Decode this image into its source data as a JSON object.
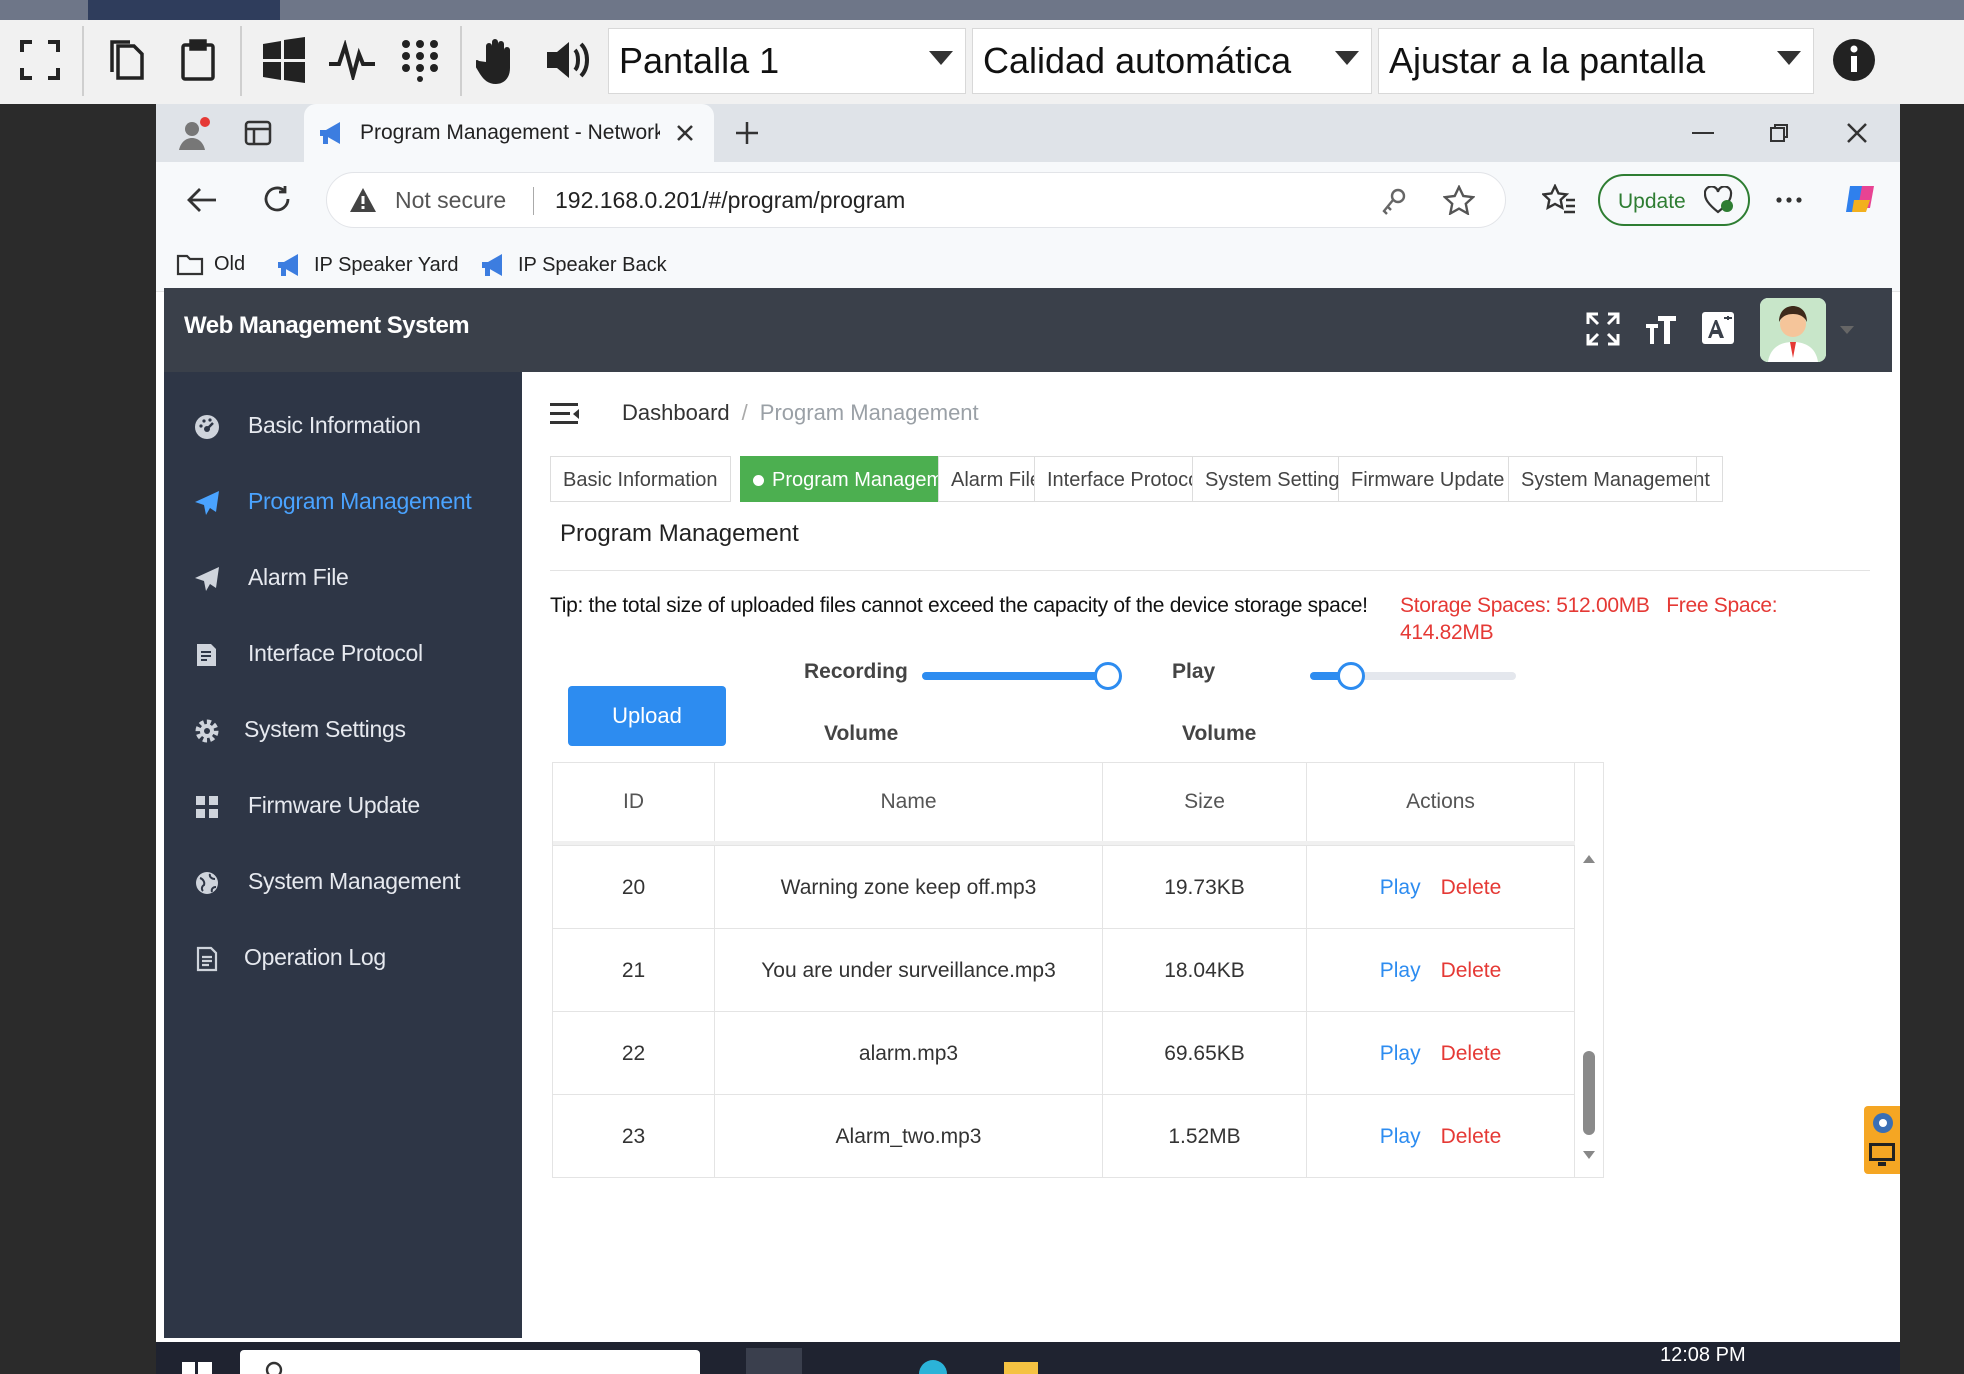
{
  "remote_toolbar": {
    "screen_select": "Pantalla 1",
    "quality_select": "Calidad automática",
    "fit_select": "Ajustar a la pantalla"
  },
  "browser": {
    "tab_title": "Program Management - Network",
    "not_secure": "Not secure",
    "url": "192.168.0.201/#/program/program",
    "update_label": "Update",
    "bookmarks": [
      {
        "label": "Old"
      },
      {
        "label": "IP Speaker Yard"
      },
      {
        "label": "IP Speaker Back"
      }
    ]
  },
  "app": {
    "title": "Web Management System",
    "sidebar": [
      {
        "label": "Basic Information",
        "icon": "dashboard-icon"
      },
      {
        "label": "Program Management",
        "icon": "send-icon",
        "active": true
      },
      {
        "label": "Alarm File",
        "icon": "send-icon"
      },
      {
        "label": "Interface Protocol",
        "icon": "document-edit-icon"
      },
      {
        "label": "System Settings",
        "icon": "gear-icon"
      },
      {
        "label": "Firmware Update",
        "icon": "grid-icon"
      },
      {
        "label": "System Management",
        "icon": "globe-icon"
      },
      {
        "label": "Operation Log",
        "icon": "file-icon"
      }
    ],
    "breadcrumb": {
      "home": "Dashboard",
      "current": "Program Management"
    },
    "tabs": [
      {
        "label": "Basic Information"
      },
      {
        "label": "Program Management",
        "active": true
      },
      {
        "label": "Alarm File"
      },
      {
        "label": "Interface Protocol"
      },
      {
        "label": "System Settings"
      },
      {
        "label": "Firmware Update"
      },
      {
        "label": "System Management"
      }
    ],
    "page_title": "Program Management",
    "tip": "Tip: the total size of uploaded files cannot exceed the capacity of the device storage space!",
    "storage_spaces": "Storage Spaces: 512.00MB",
    "free_space": "Free Space: 414.82MB",
    "upload_label": "Upload",
    "recording_volume": {
      "label_top": "Recording",
      "label_bottom": "Volume",
      "level": 1.0
    },
    "play_volume": {
      "label_top": "Play",
      "label_bottom": "Volume",
      "level": 0.2
    },
    "table": {
      "columns": [
        "ID",
        "Name",
        "Size",
        "Actions"
      ],
      "rows": [
        {
          "id": "20",
          "name": "Warning zone keep off.mp3",
          "size": "19.73KB",
          "play": "Play",
          "delete": "Delete"
        },
        {
          "id": "21",
          "name": "You are under surveillance.mp3",
          "size": "18.04KB",
          "play": "Play",
          "delete": "Delete"
        },
        {
          "id": "22",
          "name": "alarm.mp3",
          "size": "69.65KB",
          "play": "Play",
          "delete": "Delete"
        },
        {
          "id": "23",
          "name": "Alarm_two.mp3",
          "size": "1.52MB",
          "play": "Play",
          "delete": "Delete"
        }
      ]
    }
  },
  "taskbar": {
    "clock": "12:08 PM"
  }
}
